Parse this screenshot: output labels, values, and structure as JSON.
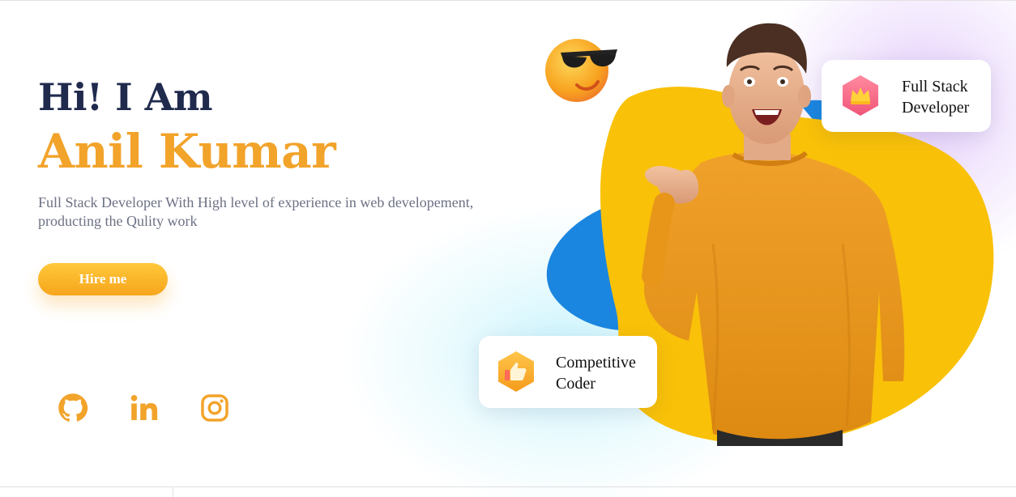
{
  "hero": {
    "greeting": "Hi! I Am",
    "name": "Anil Kumar",
    "description_line1": "Full Stack Developer With High level of experience in web developement,",
    "description_line2": "producting the Qulity work",
    "hire_label": "Hire me"
  },
  "social": [
    {
      "icon": "github-icon"
    },
    {
      "icon": "linkedin-icon"
    },
    {
      "icon": "instagram-icon"
    }
  ],
  "badges": {
    "fullstack": {
      "line1": "Full Stack",
      "line2": "Developer",
      "icon": "crown-icon"
    },
    "coder": {
      "line1": "Competitive",
      "line2": "Coder",
      "icon": "thumbs-up-icon"
    }
  },
  "colors": {
    "accent": "#f2a32a",
    "heading": "#1f2a4d",
    "blob_yellow": "#f9c108",
    "blob_blue": "#1b86e0",
    "sweater": "#e8961a"
  }
}
